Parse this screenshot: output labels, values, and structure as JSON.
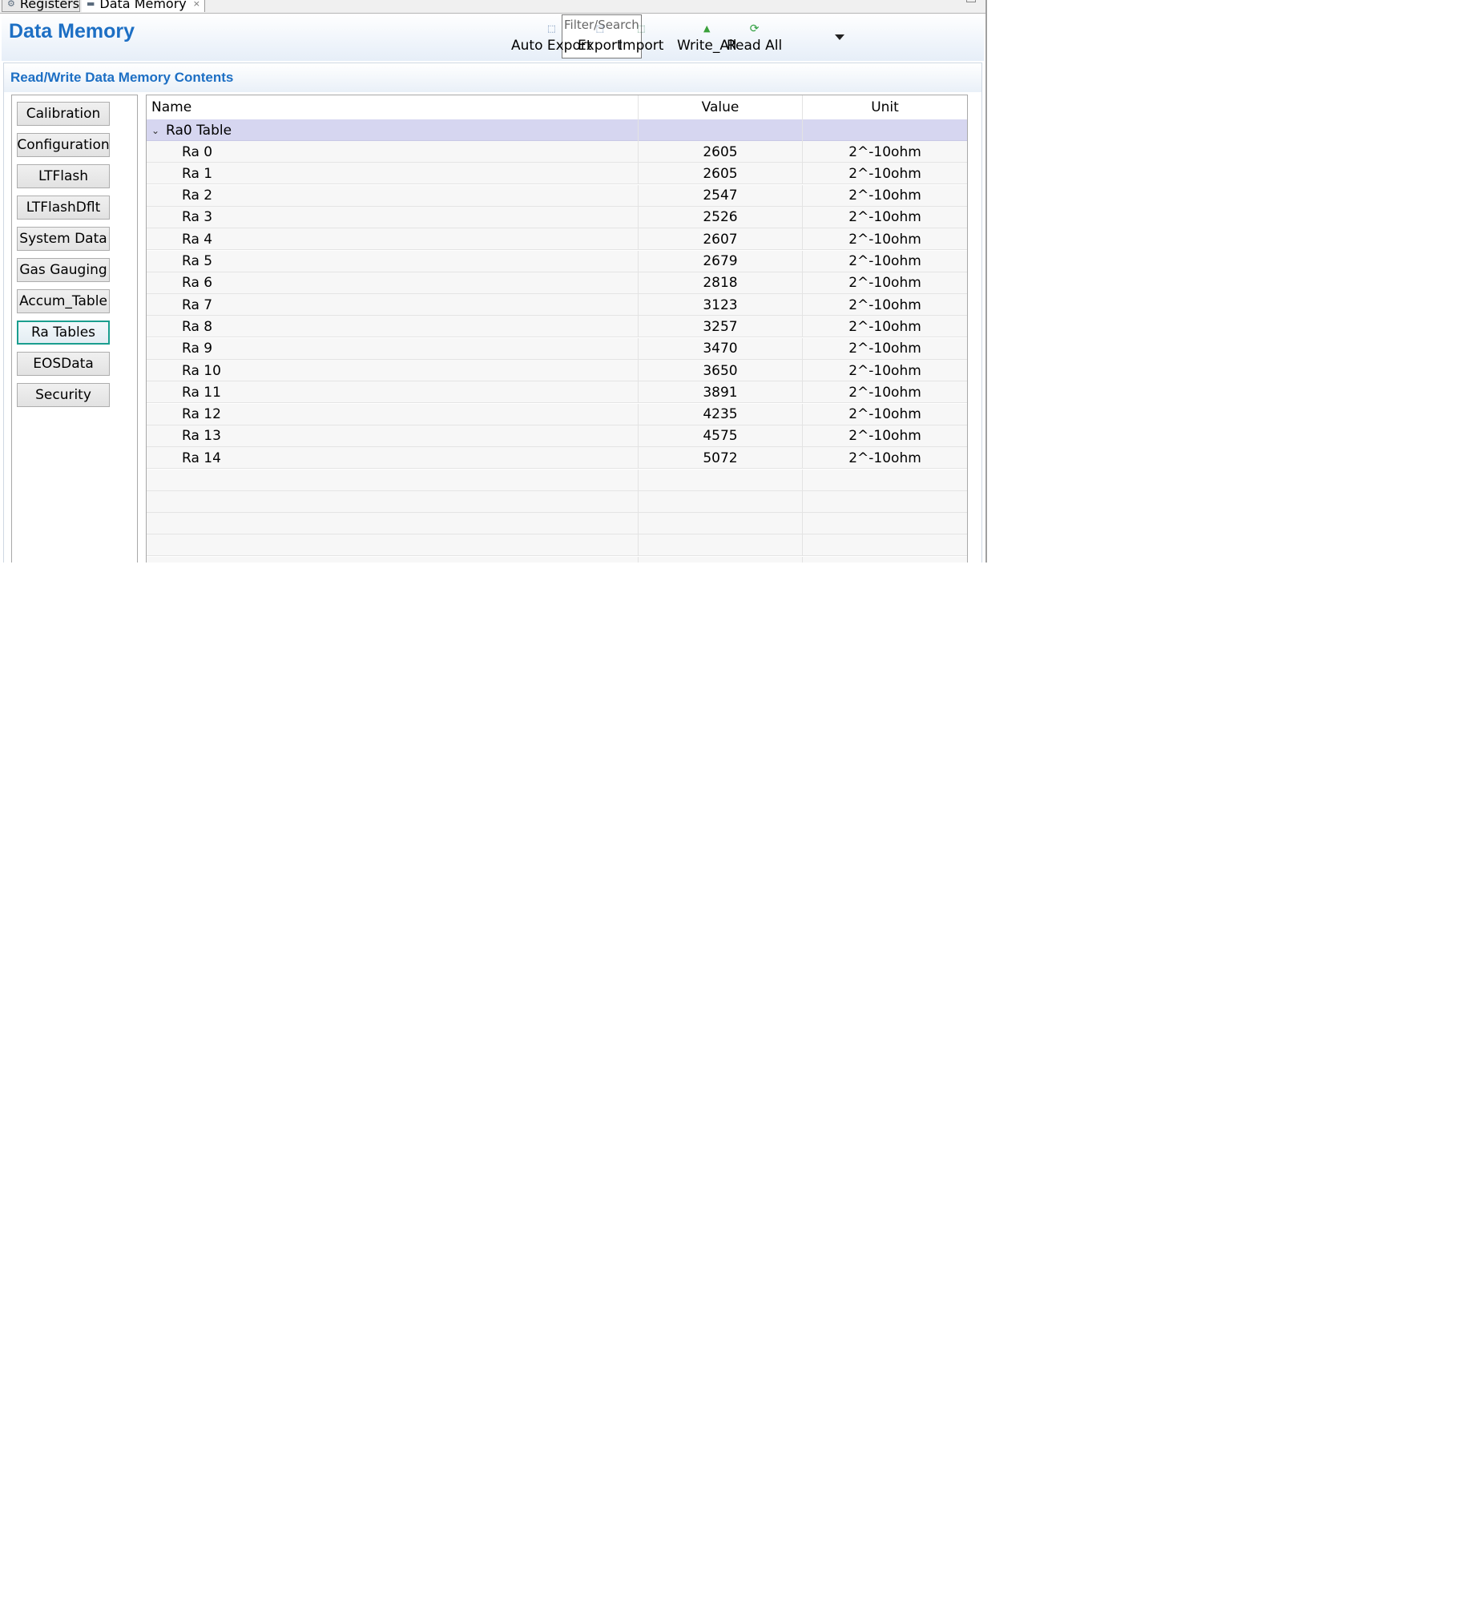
{
  "tabs": [
    {
      "label": "Registers",
      "icon": "gear-icon"
    },
    {
      "label": "Data Memory",
      "icon": "memory-icon",
      "close": "×"
    }
  ],
  "header": {
    "title": "Data Memory",
    "filter_placeholder": "Filter/Search",
    "toolbar": [
      {
        "label": "Auto Export",
        "icon": "auto-export-icon"
      },
      {
        "label": "Export",
        "icon": "export-icon"
      },
      {
        "label": "Import",
        "icon": "import-icon"
      },
      {
        "label": "Write_All",
        "icon": "write-all-icon"
      },
      {
        "label": "Read All",
        "icon": "refresh-icon"
      }
    ]
  },
  "section": {
    "title": "Read/Write Data Memory Contents"
  },
  "sidebar": {
    "items": [
      {
        "label": "Calibration"
      },
      {
        "label": "Configuration"
      },
      {
        "label": "LTFlash"
      },
      {
        "label": "LTFlashDflt"
      },
      {
        "label": "System Data"
      },
      {
        "label": "Gas Gauging"
      },
      {
        "label": "Accum_Table"
      },
      {
        "label": "Ra Tables",
        "active": true
      },
      {
        "label": "EOSData"
      },
      {
        "label": "Security"
      }
    ]
  },
  "table": {
    "columns": [
      "Name",
      "Value",
      "Unit"
    ],
    "group": {
      "name": "Ra0 Table",
      "expanded": true
    },
    "rows": [
      {
        "name": "Ra 0",
        "value": "2605",
        "unit": "2^-10ohm"
      },
      {
        "name": "Ra 1",
        "value": "2605",
        "unit": "2^-10ohm"
      },
      {
        "name": "Ra 2",
        "value": "2547",
        "unit": "2^-10ohm"
      },
      {
        "name": "Ra 3",
        "value": "2526",
        "unit": "2^-10ohm"
      },
      {
        "name": "Ra 4",
        "value": "2607",
        "unit": "2^-10ohm"
      },
      {
        "name": "Ra 5",
        "value": "2679",
        "unit": "2^-10ohm"
      },
      {
        "name": "Ra 6",
        "value": "2818",
        "unit": "2^-10ohm"
      },
      {
        "name": "Ra 7",
        "value": "3123",
        "unit": "2^-10ohm"
      },
      {
        "name": "Ra 8",
        "value": "3257",
        "unit": "2^-10ohm"
      },
      {
        "name": "Ra 9",
        "value": "3470",
        "unit": "2^-10ohm"
      },
      {
        "name": "Ra 10",
        "value": "3650",
        "unit": "2^-10ohm"
      },
      {
        "name": "Ra 11",
        "value": "3891",
        "unit": "2^-10ohm"
      },
      {
        "name": "Ra 12",
        "value": "4235",
        "unit": "2^-10ohm"
      },
      {
        "name": "Ra 13",
        "value": "4575",
        "unit": "2^-10ohm"
      },
      {
        "name": "Ra 14",
        "value": "5072",
        "unit": "2^-10ohm"
      }
    ]
  },
  "colors": {
    "accent": "#1d6fc4",
    "group_row": "#d6d6f0",
    "active_border": "#1a9e8f",
    "write_icon": "#3aa03a",
    "read_icon": "#2e9e3e"
  }
}
